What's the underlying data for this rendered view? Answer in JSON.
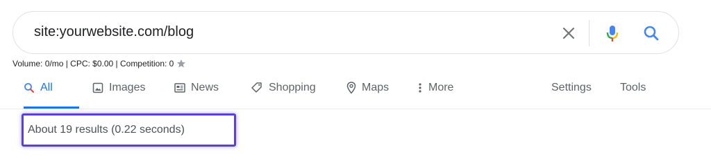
{
  "search": {
    "query": "site:yourwebsite.com/blog"
  },
  "keyword_info": {
    "text": "Volume: 0/mo | CPC: $0.00 | Competition: 0"
  },
  "tabs": [
    {
      "label": "All",
      "icon": "search-icon",
      "active": true
    },
    {
      "label": "Images",
      "icon": "image-icon",
      "active": false
    },
    {
      "label": "News",
      "icon": "news-icon",
      "active": false
    },
    {
      "label": "Shopping",
      "icon": "tag-icon",
      "active": false
    },
    {
      "label": "Maps",
      "icon": "map-pin-icon",
      "active": false
    },
    {
      "label": "More",
      "icon": "more-vert-icon",
      "active": false
    }
  ],
  "tools": {
    "settings_label": "Settings",
    "tools_label": "Tools"
  },
  "results": {
    "stats": "About 19 results (0.22 seconds)"
  },
  "colors": {
    "accent": "#1a73e8",
    "highlight_border": "#5b3fd8"
  }
}
